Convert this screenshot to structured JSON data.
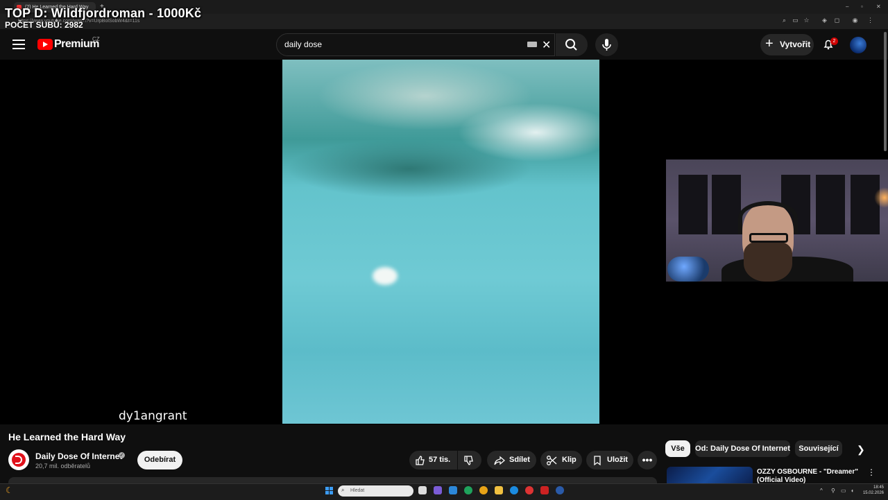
{
  "browser": {
    "tab_title": "(2) He Learned the Hard Way",
    "url": "https://www.youtube.com/watch?v=UrpBolSobW4&t=11s",
    "new_tab": "+"
  },
  "overlay": {
    "title": "TOP D: Wildfjordroman - 1000Kč",
    "subs_count": "POČET SUBŮ: 2982"
  },
  "header": {
    "logo_text": "Premium",
    "region": "CZ",
    "search_value": "daily dose",
    "create_label": "Vytvořit",
    "notifications_count": "2"
  },
  "video": {
    "watermark": "dy1angrant",
    "title": "He Learned the Hard Way"
  },
  "channel": {
    "name": "Daily Dose Of Internet",
    "subscribers": "20,7 mil. odběratelů",
    "subscribe_label": "Odebírat"
  },
  "actions": {
    "likes": "57 tis.",
    "share": "Sdílet",
    "clip": "Klip",
    "save": "Uložit",
    "more": "•••"
  },
  "chips": {
    "all": "Vše",
    "from": "Od: Daily Dose Of Internet",
    "related": "Související"
  },
  "recommendation": {
    "title": "OZZY OSBOURNE - \"Dreamer\" (Official Video)"
  },
  "taskbar": {
    "search_placeholder": "Hledat",
    "time": "18:45",
    "date": "15.02.2026"
  },
  "colors": {
    "youtube_red": "#ff0000",
    "background": "#0f0f0f",
    "start_blue": "#3b9cf6"
  },
  "icons": [
    "menu-icon",
    "youtube-logo-icon",
    "keyboard-icon",
    "clear-icon",
    "search-icon",
    "mic-icon",
    "plus-icon",
    "bell-icon",
    "verified-icon",
    "like-icon",
    "dislike-icon",
    "share-icon",
    "clip-icon",
    "save-icon",
    "more-icon",
    "chevron-right-icon",
    "windows-start-icon"
  ]
}
